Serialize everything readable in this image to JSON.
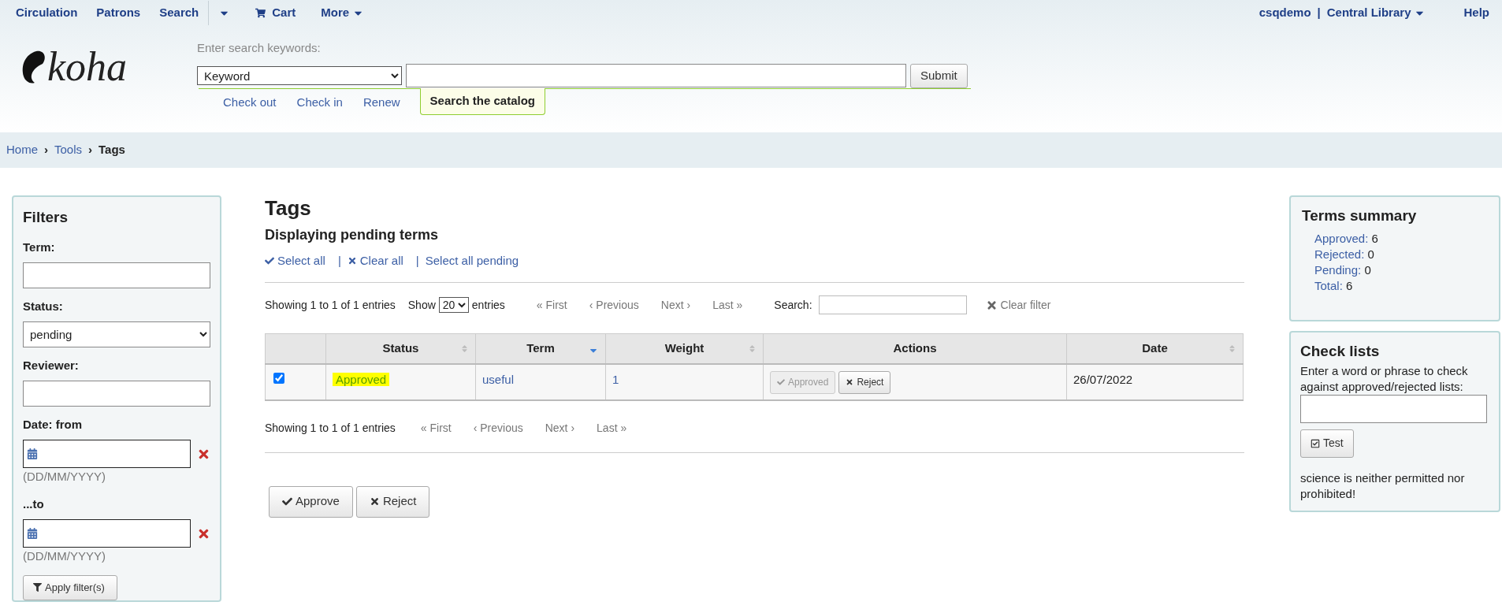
{
  "nav": {
    "items": [
      {
        "label": "Circulation",
        "kind": "link"
      },
      {
        "label": "Patrons",
        "kind": "link"
      },
      {
        "label": "Search",
        "kind": "link"
      },
      {
        "kind": "caret"
      },
      {
        "label": "Cart",
        "kind": "cart"
      },
      {
        "label": "More",
        "kind": "menu"
      }
    ],
    "user": "csqdemo",
    "separator": "|",
    "library": "Central Library",
    "help": "Help"
  },
  "header": {
    "logo": "koha",
    "search_label": "Enter search keywords:",
    "search_type": "Keyword",
    "submit": "Submit",
    "tabs": [
      {
        "label": "Check out",
        "selected": false
      },
      {
        "label": "Check in",
        "selected": false
      },
      {
        "label": "Renew",
        "selected": false
      },
      {
        "label": "Search the catalog",
        "selected": true
      }
    ]
  },
  "breadcrumbs": [
    {
      "label": "Home",
      "current": false
    },
    {
      "separator": "›",
      "label": "Tools",
      "current": false
    },
    {
      "separator": "›",
      "label": "Tags",
      "current": true
    }
  ],
  "filters": {
    "title": "Filters",
    "term_label": "Term:",
    "status_label": "Status:",
    "status_value": "pending",
    "reviewer_label": "Reviewer:",
    "date_from_label": "Date: from",
    "date_from_hint": "(DD/MM/YYYY)",
    "date_to_label": "...to",
    "date_to_hint": "(DD/MM/YYYY)",
    "apply": "Apply filter(s)"
  },
  "main": {
    "title": "Tags",
    "subtitle": "Displaying pending terms",
    "select_links": [
      {
        "label": "Select all",
        "kind": "check"
      },
      {
        "separator": "|",
        "label": "Clear all",
        "kind": "cross"
      },
      {
        "separator": "|",
        "label": "Select all pending",
        "kind": "plain"
      }
    ],
    "info": "Showing 1 to 1 of 1 entries",
    "show_label": "Show",
    "page_size": "20",
    "entries_label": "entries",
    "pager": [
      {
        "prefix": "«",
        "label": "First"
      },
      {
        "prefix": "‹",
        "label": "Previous"
      },
      {
        "label": "Next",
        "suffix": "›"
      },
      {
        "label": "Last",
        "suffix": "»"
      }
    ],
    "search_label": "Search:",
    "clear_filter": "Clear filter",
    "columns": [
      {
        "sortable": false
      },
      {
        "label": "Status",
        "sortable": true,
        "sorted": false
      },
      {
        "label": "Term",
        "sortable": true,
        "sorted": true
      },
      {
        "label": "Weight",
        "sortable": true,
        "sorted": false
      },
      {
        "label": "Actions",
        "sortable": false
      },
      {
        "label": "Date",
        "sortable": true,
        "sorted": false
      }
    ],
    "rows": [
      {
        "checked": true,
        "status": "Approved",
        "highlighted": true,
        "term": "useful",
        "weight": "1",
        "approve_label": "Approved",
        "approve_disabled": true,
        "reject_label": "Reject",
        "date": "26/07/2022"
      }
    ],
    "bottom_info": "Showing 1 to 1 of 1 entries",
    "bottom_pager": [
      {
        "prefix": "«",
        "label": "First"
      },
      {
        "prefix": "‹",
        "label": "Previous"
      },
      {
        "label": "Next",
        "suffix": "›"
      },
      {
        "label": "Last",
        "suffix": "»"
      }
    ],
    "approve": "Approve",
    "reject": "Reject"
  },
  "summary": {
    "title": "Terms summary",
    "items": [
      {
        "label": "Approved:",
        "value": "6"
      },
      {
        "label": "Rejected:",
        "value": "0"
      },
      {
        "label": "Pending:",
        "value": "0"
      },
      {
        "label": "Total:",
        "value": "6"
      }
    ]
  },
  "check_lists": {
    "title": "Check lists",
    "prompt": "Enter a word or phrase to check against approved/rejected lists:",
    "test": "Test",
    "result": "science is neither permitted nor prohibited!"
  }
}
